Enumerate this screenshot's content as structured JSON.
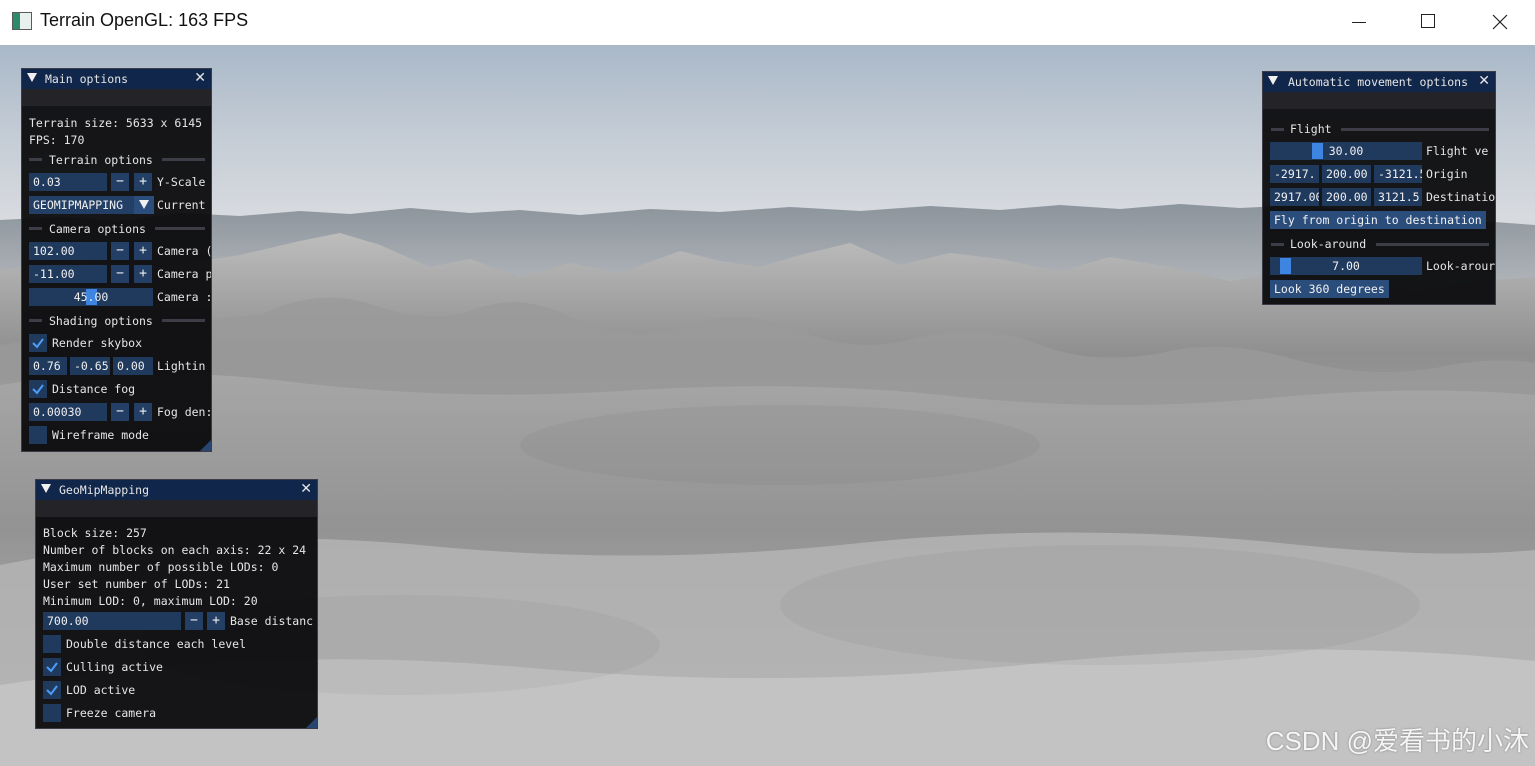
{
  "window": {
    "title": "Terrain OpenGL: 163 FPS",
    "icon": "app-window-icon"
  },
  "main_options": {
    "title": "Main options",
    "terrain_size": "Terrain size: 5633 x 6145",
    "fps": "FPS: 170",
    "terrain_section": "Terrain options",
    "y_scale": {
      "value": "0.03",
      "label": "Y-Scale"
    },
    "render_mode": {
      "value": "GEOMIPMAPPING",
      "label": "Current"
    },
    "camera_section": "Camera options",
    "camera_field_1": {
      "value": "102.00",
      "label": "Camera ("
    },
    "camera_field_2": {
      "value": "-11.00",
      "label": "Camera p"
    },
    "camera_field_3": {
      "value": "45.00",
      "label": "Camera :",
      "slider_fraction": 0.5
    },
    "shading_section": "Shading options",
    "render_skybox": {
      "label": "Render skybox",
      "checked": true
    },
    "lighting": {
      "x": "0.76",
      "y": "-0.65",
      "z": "0.00",
      "label": "Lightin"
    },
    "distance_fog": {
      "label": "Distance fog",
      "checked": true
    },
    "fog_density": {
      "value": "0.00030",
      "label": "Fog den:"
    },
    "wireframe": {
      "label": "Wireframe mode",
      "checked": false
    },
    "minus": "−",
    "plus": "+"
  },
  "geomipmapping": {
    "title": "GeoMipMapping",
    "lines": [
      "Block size: 257",
      "Number of blocks on each axis: 22 x 24",
      "Maximum number of possible LODs: 0",
      "User set number of LODs: 21",
      "Minimum LOD: 0, maximum LOD: 20"
    ],
    "base_distance": {
      "value": "700.00",
      "label": "Base distanc"
    },
    "double_distance": {
      "label": "Double distance each level",
      "checked": false
    },
    "culling": {
      "label": "Culling active",
      "checked": true
    },
    "lod": {
      "label": "LOD active",
      "checked": true
    },
    "freeze": {
      "label": "Freeze camera",
      "checked": false
    }
  },
  "auto_movement": {
    "title": "Automatic movement options",
    "flight_section": "Flight",
    "flight_velocity": {
      "value": "30.00",
      "label": "Flight ve",
      "slider_fraction": 0.3
    },
    "origin": {
      "x": "-2917.",
      "y": "200.00",
      "z": "-3121.5",
      "label": "Origin"
    },
    "destination": {
      "x": "2917.00",
      "y": "200.00",
      "z": "3121.5",
      "label": "Destinatio"
    },
    "fly_button": "Fly from origin to destination",
    "lookaround_section": "Look-around",
    "look_speed": {
      "value": "7.00",
      "label": "Look-arour",
      "slider_fraction": 0.07
    },
    "look_button": "Look 360 degrees"
  },
  "watermark": "CSDN @爱看书的小沐"
}
